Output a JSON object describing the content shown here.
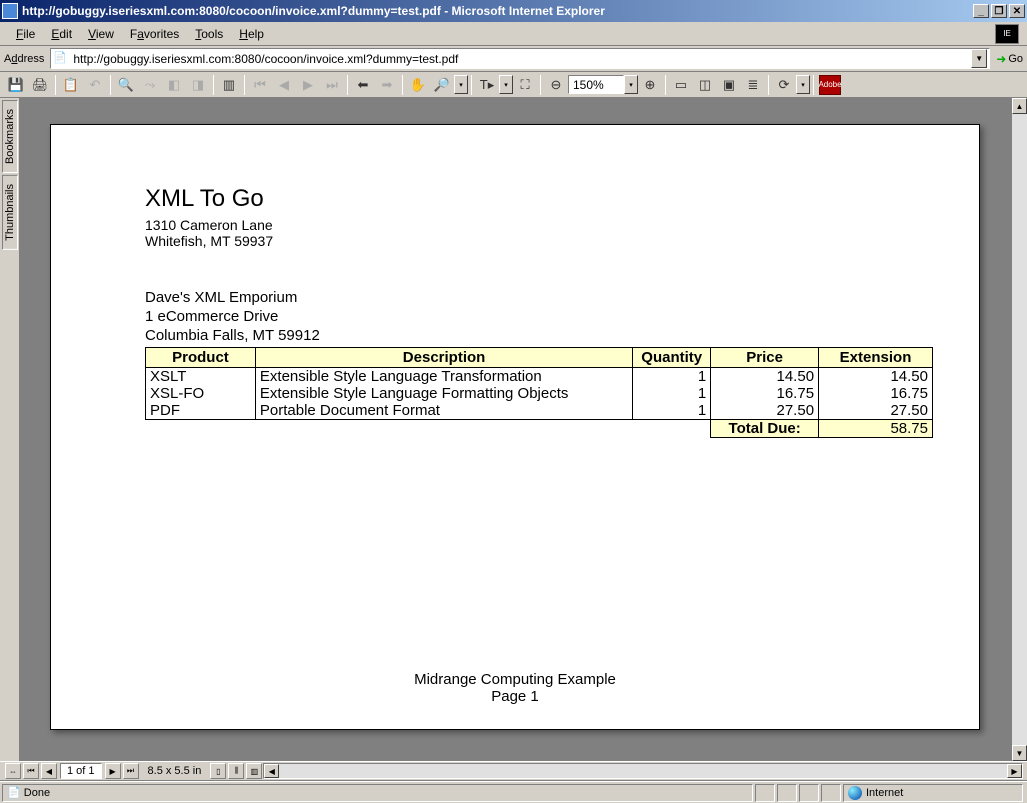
{
  "window": {
    "title": "http://gobuggy.iseriesxml.com:8080/cocoon/invoice.xml?dummy=test.pdf - Microsoft Internet Explorer"
  },
  "menu": {
    "file": "File",
    "edit": "Edit",
    "view": "View",
    "favorites": "Favorites",
    "tools": "Tools",
    "help": "Help"
  },
  "address": {
    "label": "Address",
    "url": "http://gobuggy.iseriesxml.com:8080/cocoon/invoice.xml?dummy=test.pdf",
    "go": "Go"
  },
  "sidetabs": {
    "bookmarks": "Bookmarks",
    "thumbnails": "Thumbnails"
  },
  "acrobat": {
    "zoom": "150%",
    "page_of": "1 of 1",
    "dimensions": "8.5 x 5.5 in"
  },
  "invoice": {
    "company": {
      "name": "XML To Go",
      "street": "1310 Cameron Lane",
      "city": "Whitefish, MT 59937"
    },
    "billto": {
      "name": "Dave's XML Emporium",
      "street": "1 eCommerce Drive",
      "city": "Columbia Falls, MT 59912"
    },
    "headers": {
      "product": "Product",
      "description": "Description",
      "quantity": "Quantity",
      "price": "Price",
      "extension": "Extension"
    },
    "rows": [
      {
        "product": "XSLT",
        "description": "Extensible Style Language Transformation",
        "quantity": "1",
        "price": "14.50",
        "extension": "14.50"
      },
      {
        "product": "XSL-FO",
        "description": "Extensible Style Language Formatting Objects",
        "quantity": "1",
        "price": "16.75",
        "extension": "16.75"
      },
      {
        "product": "PDF",
        "description": "Portable Document Format",
        "quantity": "1",
        "price": "27.50",
        "extension": "27.50"
      }
    ],
    "total_label": "Total Due:",
    "total_value": "58.75",
    "footer_line1": "Midrange Computing Example",
    "footer_line2": "Page 1"
  },
  "status": {
    "done": "Done",
    "zone": "Internet"
  }
}
